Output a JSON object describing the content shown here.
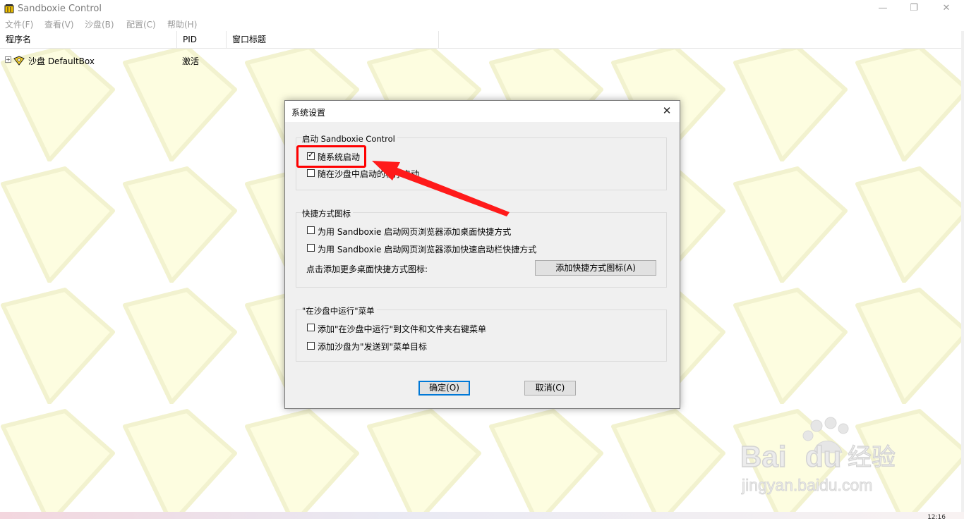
{
  "window": {
    "title": "Sandboxie Control",
    "minimize": "—",
    "restore": "❐",
    "close": "✕"
  },
  "menu": [
    "文件(F)",
    "查看(V)",
    "沙盘(B)",
    "配置(C)",
    "帮助(H)"
  ],
  "columns": [
    "程序名",
    "PID",
    "窗口标题"
  ],
  "rows": [
    {
      "expander": "+",
      "name": "沙盘 DefaultBox",
      "status": "激活"
    }
  ],
  "dialog": {
    "title": "系统设置",
    "close": "✕",
    "group_startup": {
      "label": "启动 Sandboxie Control",
      "options": [
        {
          "label": "随系统启动",
          "checked": true
        },
        {
          "label": "随在沙盘中启动的程序启动",
          "checked": false
        }
      ]
    },
    "group_shortcuts": {
      "label": "快捷方式图标",
      "options": [
        {
          "label": "为用 Sandboxie 启动网页浏览器添加桌面快捷方式",
          "checked": false
        },
        {
          "label": "为用 Sandboxie 启动网页浏览器添加快速启动栏快捷方式",
          "checked": false
        }
      ],
      "more_label": "点击添加更多桌面快捷方式图标:",
      "add_button": "添加快捷方式图标(A)"
    },
    "group_menu": {
      "label": "\"在沙盘中运行\"菜单",
      "options": [
        {
          "label": "添加\"在沙盘中运行\"到文件和文件夹右键菜单",
          "checked": false
        },
        {
          "label": "添加沙盘为\"发送到\"菜单目标",
          "checked": false
        }
      ]
    },
    "ok_button": "确定(O)",
    "cancel_button": "取消(C)"
  },
  "watermark": {
    "brand": "Baidu",
    "cn": "经验",
    "url": "jingyan.baidu.com"
  },
  "taskbar_clock": "12:16",
  "colors": {
    "pattern_fill": "#fdfde0",
    "pattern_stroke": "#f2f2cf",
    "highlight": "#ff0000",
    "arrow": "#ff1a1a",
    "default_button": "#0078d7"
  }
}
